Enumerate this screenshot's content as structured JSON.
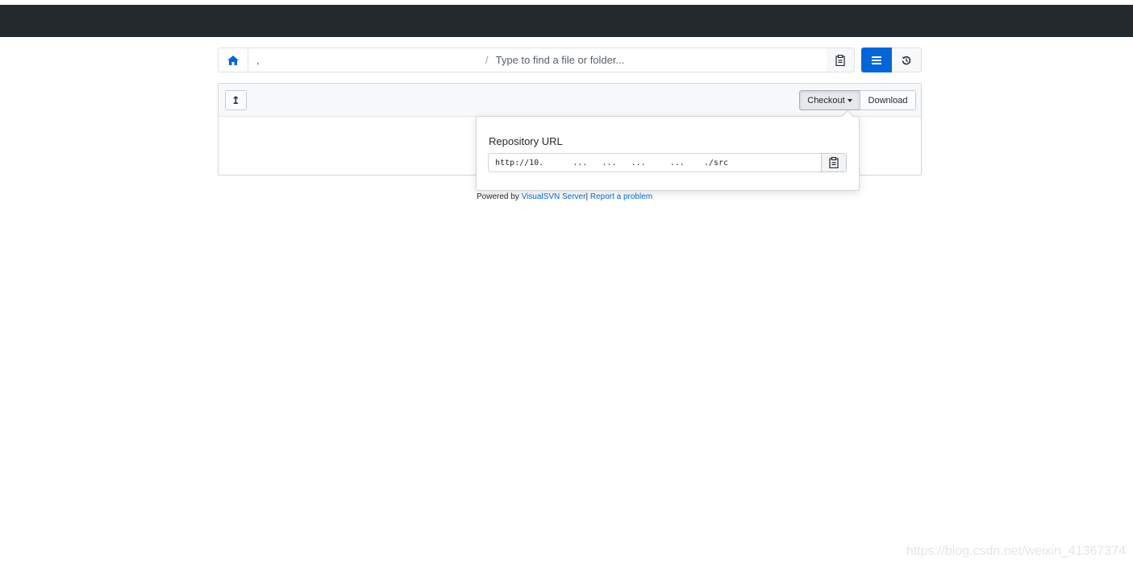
{
  "pathbar": {
    "home_icon": "home-icon",
    "breadcrumb": ",",
    "separator": "/",
    "search_placeholder": "Type to find a file or folder...",
    "copy_path_icon": "clipboard-icon"
  },
  "view": {
    "list_icon": "list-icon",
    "history_icon": "history-icon",
    "active_color": "#0366d6"
  },
  "toolbar": {
    "up_label": "↥",
    "checkout_label": "Checkout",
    "download_label": "Download"
  },
  "popover": {
    "title": "Repository URL",
    "url": "http://10.      ...   ...   ...     ...    ./src",
    "copy_icon": "clipboard-icon"
  },
  "footer": {
    "powered_by": "Powered by",
    "link_server": "VisualSVN Server",
    "divider": "|",
    "link_report": "Report a problem"
  },
  "watermark": "https://blog.csdn.net/weixin_41367374",
  "colors": {
    "topbar": "#24292e",
    "link": "#0366d6"
  }
}
